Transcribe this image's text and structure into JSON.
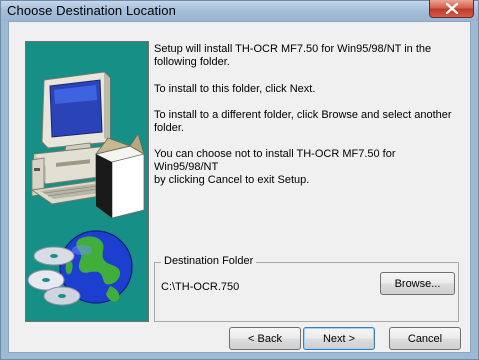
{
  "window": {
    "title": "Choose Destination Location"
  },
  "info": {
    "line1": "Setup will install TH-OCR MF7.50 for Win95/98/NT in the",
    "line2": "following folder.",
    "line3": "To install to this folder, click Next.",
    "line4": "To install to a different folder, click Browse and select another",
    "line5": "folder.",
    "line6": "You can choose not to install TH-OCR MF7.50 for Win95/98/NT",
    "line7": "by clicking Cancel to exit Setup."
  },
  "destination": {
    "legend": "Destination Folder",
    "path": "C:\\TH-OCR.750"
  },
  "buttons": {
    "browse": "Browse...",
    "back": "< Back",
    "next": "Next >",
    "cancel": "Cancel"
  },
  "icons": {
    "close": "close-icon",
    "art": "computer-globe-cd-illustration"
  },
  "colors": {
    "title_bar": "#a6c0db",
    "close_button": "#c0392b",
    "art_background": "#168f86",
    "dialog_background": "#f0f0f0"
  }
}
